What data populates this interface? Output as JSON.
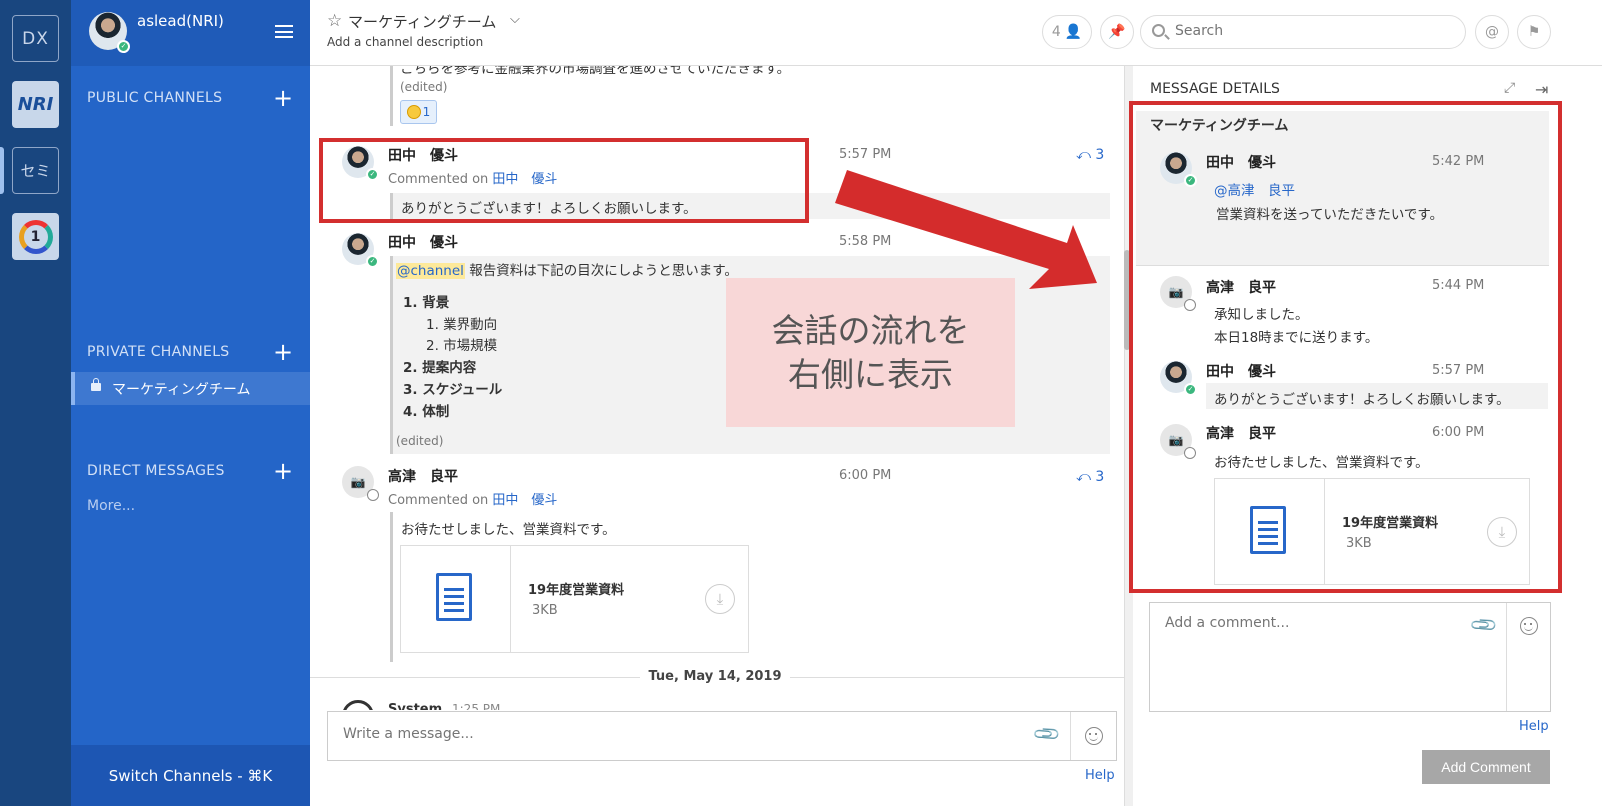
{
  "teams": {
    "dx": "DX",
    "nri": "NRI",
    "semi": "セミ",
    "one": "1"
  },
  "sidebar": {
    "username": "aslead(NRI)",
    "public_channels": "PUBLIC CHANNELS",
    "private_channels": "PRIVATE CHANNELS",
    "private_items": [
      "マーケティングチーム"
    ],
    "direct_messages": "DIRECT MESSAGES",
    "more": "More...",
    "switch_channels": "Switch Channels - ⌘K"
  },
  "header": {
    "title": "マーケティングチーム",
    "description": "Add a channel description",
    "member_count": "4",
    "search_placeholder": "Search"
  },
  "center": {
    "top_partial_text": "こちらを参考に金融業界の市場調査を進めさせていただきます。",
    "top_edited": "(edited)",
    "reaction_count": "1",
    "messages": [
      {
        "user": "田中　優斗",
        "time": "5:57 PM",
        "commented_prefix": "Commented on",
        "commented_user": "田中　優斗",
        "reply_count": "3",
        "text": "ありがとうございます！よろしくお願いします。"
      },
      {
        "user": "田中　優斗",
        "time": "5:58 PM",
        "mention": "@channel",
        "text": "報告資料は下記の目次にしようと思います。",
        "list": [
          "1. 背景",
          "1. 業界動向",
          "2. 市場規模",
          "2. 提案内容",
          "3. スケジュール",
          "4. 体制"
        ],
        "edited": "(edited)"
      },
      {
        "user": "高津　良平",
        "time": "6:00 PM",
        "commented_prefix": "Commented on",
        "commented_user": "田中　優斗",
        "reply_count": "3",
        "text": "お待たせしました、営業資料です。",
        "file_name": "19年度営業資料",
        "file_size": "3KB"
      }
    ],
    "date_separator": "Tue, May 14, 2019",
    "next_partial_user": "System",
    "next_partial_time": "1:25 PM",
    "input_placeholder": "Write a message...",
    "help": "Help"
  },
  "annotation": {
    "line1": "会話の流れを",
    "line2": "右側に表示"
  },
  "right_panel": {
    "title": "MESSAGE DETAILS",
    "channel": "マーケティングチーム",
    "root": {
      "user": "田中　優斗",
      "time": "5:42 PM",
      "mention": "@高津　良平",
      "text": "営業資料を送っていただきたいです。"
    },
    "replies": [
      {
        "user": "高津　良平",
        "time": "5:44 PM",
        "lines": [
          "承知しました。",
          "本日18時までに送ります。"
        ]
      },
      {
        "user": "田中　優斗",
        "time": "5:57 PM",
        "lines": [
          "ありがとうございます！よろしくお願いします。"
        ]
      },
      {
        "user": "高津　良平",
        "time": "6:00 PM",
        "lines": [
          "お待たせしました、営業資料です。"
        ],
        "file_name": "19年度営業資料",
        "file_size": "3KB"
      }
    ],
    "comment_placeholder": "Add a comment...",
    "help": "Help",
    "add_comment": "Add Comment"
  }
}
